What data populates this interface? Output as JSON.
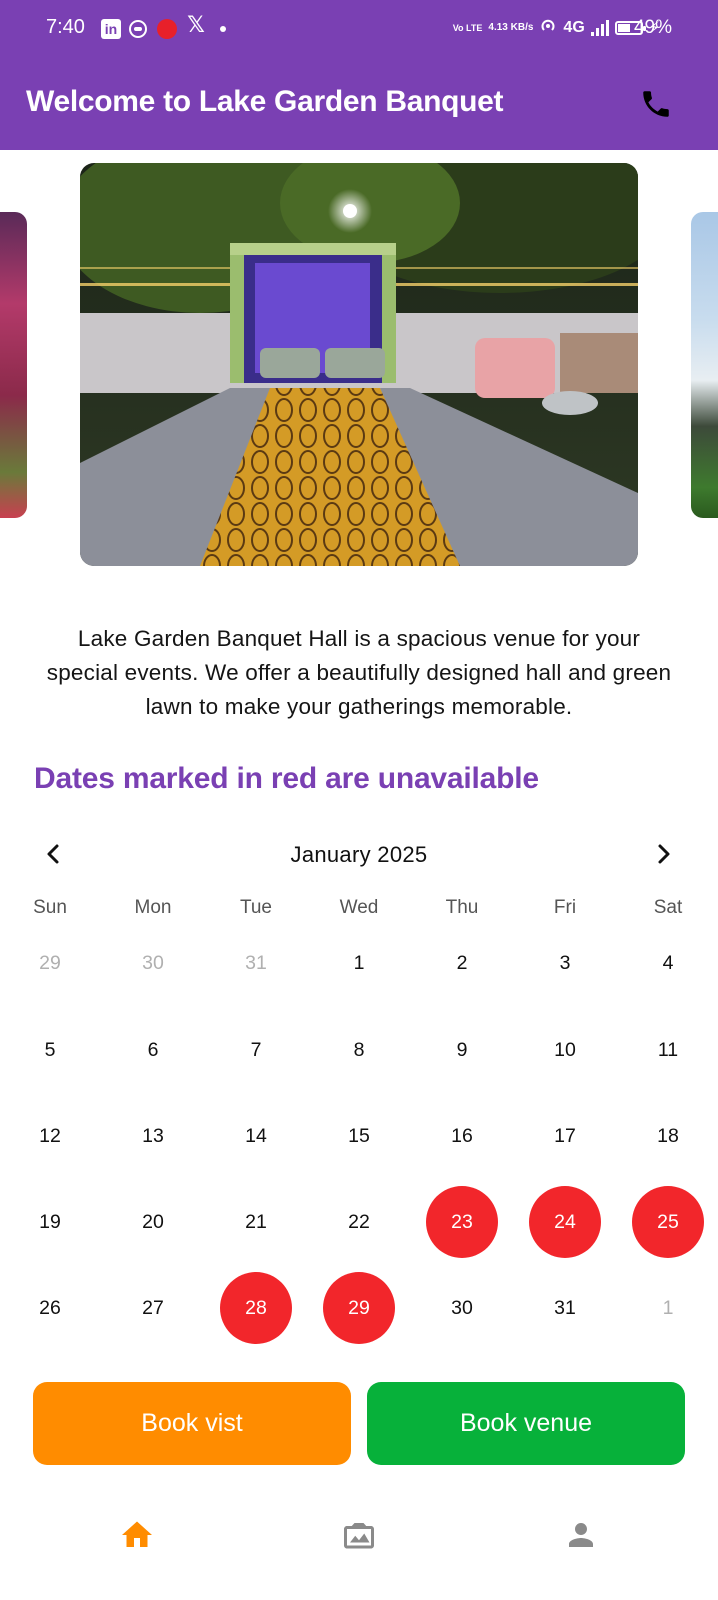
{
  "status_bar": {
    "time": "7:40",
    "network_speed": "4.13 KB/s",
    "volte": "Vo LTE",
    "network_type": "4G",
    "battery_percent": "49%",
    "notification_icons": [
      "linkedin-icon",
      "app-circle-icon",
      "red-app-icon",
      "x-icon",
      "more-dot-icon"
    ]
  },
  "app_bar": {
    "title": "Welcome to Lake Garden Banquet",
    "action_icon": "phone-icon",
    "color": "#7a40b3"
  },
  "carousel": {
    "images": [
      "decorated wedding stage with patterned carpet walkway",
      "pink floral decor",
      "building with lawn"
    ],
    "active_index": 1
  },
  "description": "Lake Garden Banquet Hall is a spacious venue for your special events. We offer a beautifully designed hall and green lawn to make your gatherings memorable.",
  "notice": "Dates marked in red are unavailable",
  "calendar": {
    "month_label": "January 2025",
    "weekdays": [
      "Sun",
      "Mon",
      "Tue",
      "Wed",
      "Thu",
      "Fri",
      "Sat"
    ],
    "weeks": [
      [
        {
          "d": "29",
          "s": "out"
        },
        {
          "d": "30",
          "s": "out"
        },
        {
          "d": "31",
          "s": "out"
        },
        {
          "d": "1",
          "s": "in"
        },
        {
          "d": "2",
          "s": "in"
        },
        {
          "d": "3",
          "s": "in"
        },
        {
          "d": "4",
          "s": "in"
        }
      ],
      [
        {
          "d": "5",
          "s": "in"
        },
        {
          "d": "6",
          "s": "in"
        },
        {
          "d": "7",
          "s": "in"
        },
        {
          "d": "8",
          "s": "in"
        },
        {
          "d": "9",
          "s": "in"
        },
        {
          "d": "10",
          "s": "in"
        },
        {
          "d": "11",
          "s": "in"
        }
      ],
      [
        {
          "d": "12",
          "s": "in"
        },
        {
          "d": "13",
          "s": "in"
        },
        {
          "d": "14",
          "s": "in"
        },
        {
          "d": "15",
          "s": "in"
        },
        {
          "d": "16",
          "s": "in"
        },
        {
          "d": "17",
          "s": "in"
        },
        {
          "d": "18",
          "s": "in"
        }
      ],
      [
        {
          "d": "19",
          "s": "in"
        },
        {
          "d": "20",
          "s": "in"
        },
        {
          "d": "21",
          "s": "in"
        },
        {
          "d": "22",
          "s": "in"
        },
        {
          "d": "23",
          "s": "unavailable"
        },
        {
          "d": "24",
          "s": "unavailable"
        },
        {
          "d": "25",
          "s": "unavailable"
        }
      ],
      [
        {
          "d": "26",
          "s": "in"
        },
        {
          "d": "27",
          "s": "in"
        },
        {
          "d": "28",
          "s": "unavailable"
        },
        {
          "d": "29",
          "s": "unavailable"
        },
        {
          "d": "30",
          "s": "in"
        },
        {
          "d": "31",
          "s": "in"
        },
        {
          "d": "1",
          "s": "out"
        }
      ]
    ],
    "unavailable_color": "#f2262b"
  },
  "buttons": {
    "book_visit": "Book vist",
    "book_venue": "Book venue",
    "visit_color": "#ff8c00",
    "venue_color": "#07b13a"
  },
  "bottom_nav": {
    "items": [
      "home-icon",
      "gallery-icon",
      "profile-icon"
    ],
    "active": "home-icon",
    "active_color": "#ff8c00"
  }
}
